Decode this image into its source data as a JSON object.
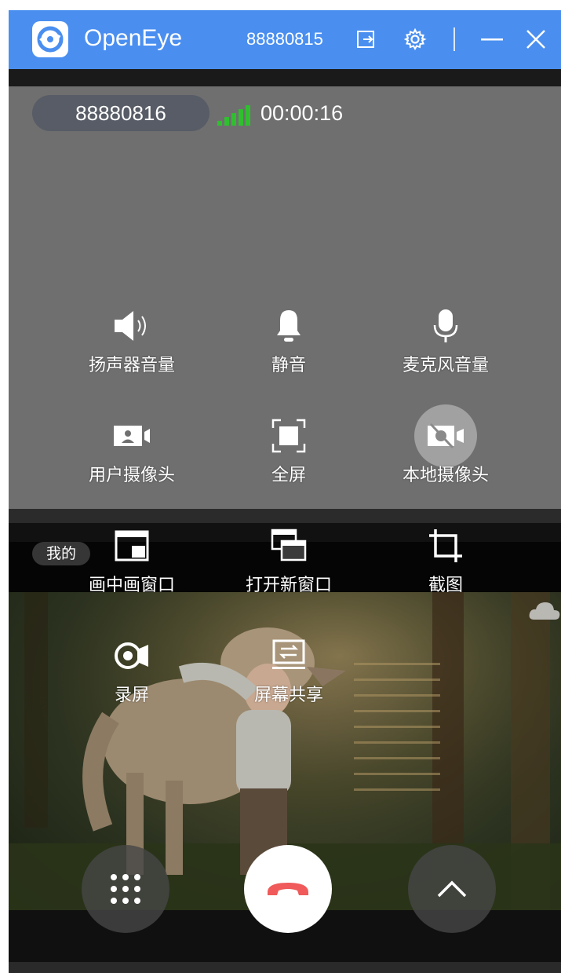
{
  "window": {
    "app_title": "OpenEye",
    "account_number": "88880815",
    "icons": [
      "logout-icon",
      "gear-icon",
      "minimize-icon",
      "close-icon"
    ]
  },
  "call": {
    "remote_number": "88880816",
    "duration": "00:00:16",
    "signal_bars": 5
  },
  "local": {
    "badge": "我的"
  },
  "controls": [
    {
      "label": "扬声器音量",
      "icon": "speaker-icon"
    },
    {
      "label": "静音",
      "icon": "bell-icon"
    },
    {
      "label": "麦克风音量",
      "icon": "microphone-icon"
    },
    {
      "label": "用户摄像头",
      "icon": "user-camera-icon"
    },
    {
      "label": "全屏",
      "icon": "fullscreen-icon"
    },
    {
      "label": "本地摄像头",
      "icon": "camera-off-icon",
      "active": true
    },
    {
      "label": "画中画窗口",
      "icon": "picture-in-picture-icon"
    },
    {
      "label": "打开新窗口",
      "icon": "new-window-icon"
    },
    {
      "label": "截图",
      "icon": "crop-icon"
    },
    {
      "label": "录屏",
      "icon": "record-icon"
    },
    {
      "label": "屏幕共享",
      "icon": "screen-share-icon"
    }
  ],
  "bottom_buttons": [
    "keypad-icon",
    "hangup-icon",
    "chevron-up-icon"
  ],
  "colors": {
    "titlebar": "#4a8ff0",
    "remote_bg": "#6f6f6f",
    "signal": "#2fbf2f",
    "hangup": "#f05a5a"
  }
}
